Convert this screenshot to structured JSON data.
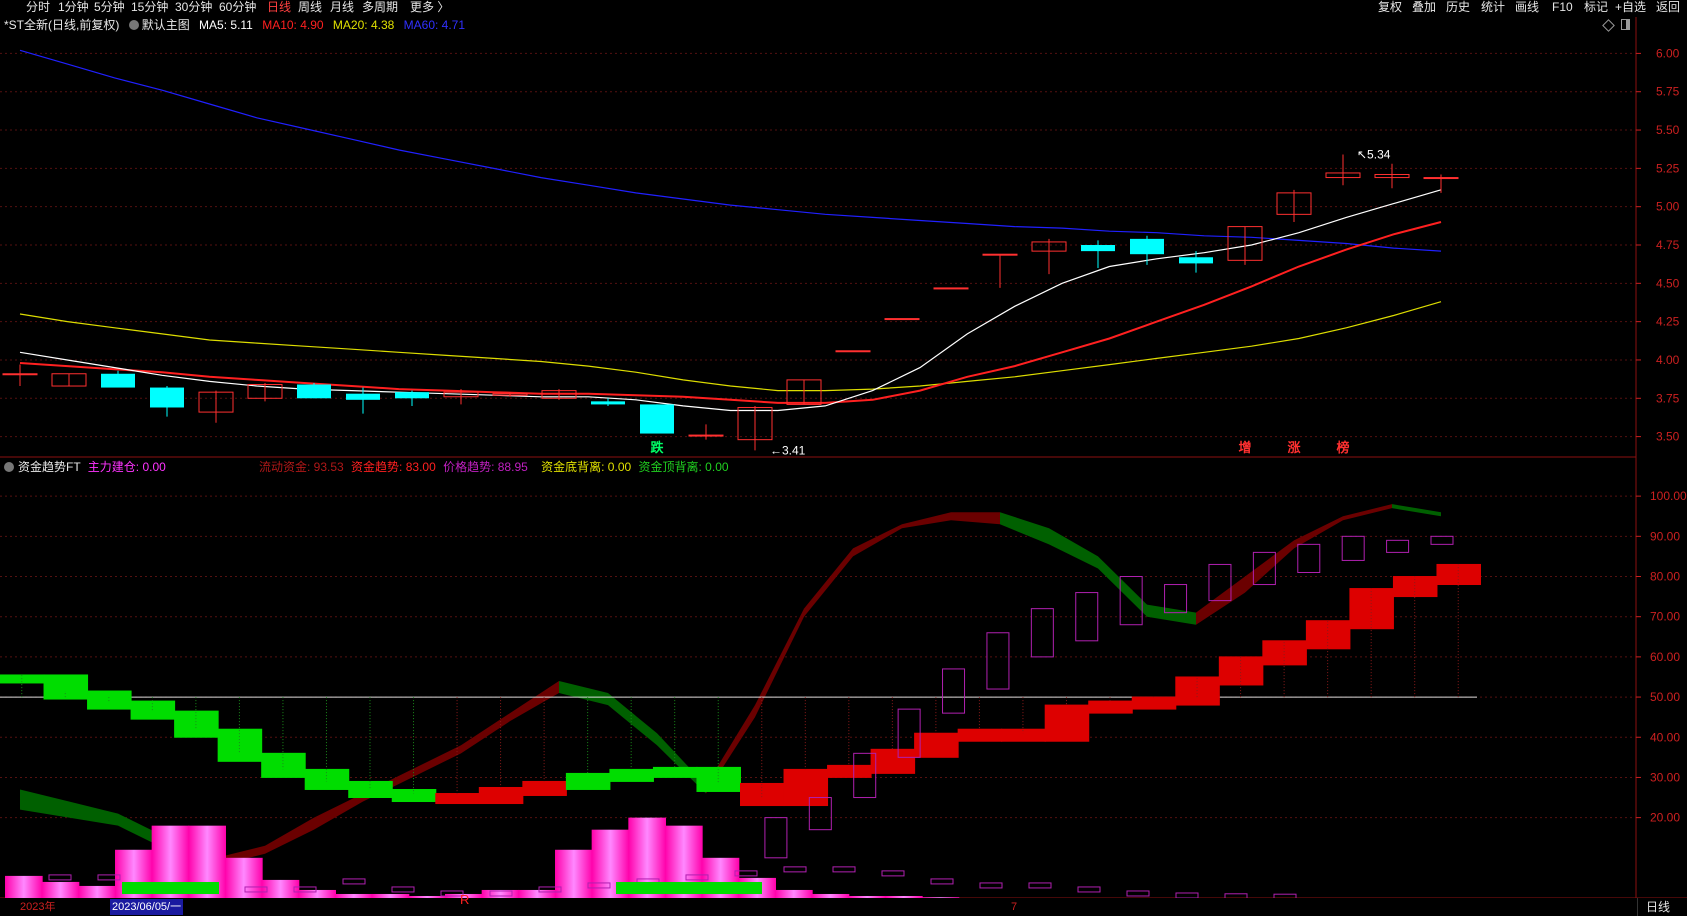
{
  "toolbar": {
    "left": [
      "分时",
      "1分钟",
      "5分钟",
      "15分钟",
      "30分钟",
      "60分钟",
      "日线",
      "周线",
      "月线",
      "多周期",
      "更多"
    ],
    "right": [
      "复权",
      "叠加",
      "历史",
      "统计",
      "画线",
      "F10",
      "标记",
      "+自选",
      "返回"
    ],
    "active": "日线",
    "more_arrow": "〉"
  },
  "main_legend": {
    "title": "*ST全新(日线,前复权)",
    "template": "默认主图",
    "ma5": "MA5: 5.11",
    "ma10": "MA10: 4.90",
    "ma20": "MA20: 4.38",
    "ma60": "MA60: 4.71"
  },
  "sub_legend": {
    "title": "资金趋势FT",
    "zhuli": "主力建仓: 0.00",
    "liudong": "流动资金: 93.53",
    "zijin_qushi": "资金趋势: 83.00",
    "jiage_qushi": "价格趋势: 88.95",
    "dibei": "资金底背离: 0.00",
    "dingbei": "资金顶背离: 0.00"
  },
  "colors": {
    "up": "#ff3030",
    "down": "#00ffff",
    "ma5": "#ffffff",
    "ma10": "#ff2020",
    "ma20": "#dddd00",
    "ma60": "#2020ff",
    "axis": "#cc2020",
    "grid": "#551111",
    "green_bar": "#00dd00",
    "red_bar": "#dd0000",
    "magenta": "#ff00ff"
  },
  "chart_data": {
    "type": "candlestick",
    "ylim": [
      3.38,
      6.12
    ],
    "yticks": [
      3.5,
      3.75,
      4.0,
      4.25,
      4.5,
      4.75,
      5.0,
      5.25,
      5.5,
      5.75,
      6.0
    ],
    "ytick_labels": [
      "3.50",
      "3.75",
      "4.00",
      "4.25",
      "4.50",
      "4.75",
      "5.00",
      "5.25",
      "5.50",
      "5.75",
      "6.00"
    ],
    "candles": [
      {
        "o": 3.91,
        "h": 3.97,
        "l": 3.83,
        "c": 3.91
      },
      {
        "o": 3.83,
        "h": 3.91,
        "l": 3.83,
        "c": 3.91
      },
      {
        "o": 3.91,
        "h": 3.93,
        "l": 3.82,
        "c": 3.82
      },
      {
        "o": 3.82,
        "h": 3.83,
        "l": 3.63,
        "c": 3.69
      },
      {
        "o": 3.66,
        "h": 3.8,
        "l": 3.59,
        "c": 3.79
      },
      {
        "o": 3.75,
        "h": 3.85,
        "l": 3.73,
        "c": 3.84
      },
      {
        "o": 3.84,
        "h": 3.85,
        "l": 3.75,
        "c": 3.75
      },
      {
        "o": 3.78,
        "h": 3.82,
        "l": 3.65,
        "c": 3.74
      },
      {
        "o": 3.79,
        "h": 3.8,
        "l": 3.7,
        "c": 3.75
      },
      {
        "o": 3.76,
        "h": 3.81,
        "l": 3.71,
        "c": 3.79
      },
      {
        "o": 3.77,
        "h": 3.79,
        "l": 3.76,
        "c": 3.78
      },
      {
        "o": 3.75,
        "h": 3.81,
        "l": 3.74,
        "c": 3.8
      },
      {
        "o": 3.73,
        "h": 3.75,
        "l": 3.7,
        "c": 3.71
      },
      {
        "o": 3.71,
        "h": 3.71,
        "l": 3.52,
        "c": 3.52
      },
      {
        "o": 3.51,
        "h": 3.58,
        "l": 3.48,
        "c": 3.51
      },
      {
        "o": 3.48,
        "h": 3.7,
        "l": 3.41,
        "c": 3.69
      },
      {
        "o": 3.71,
        "h": 3.87,
        "l": 3.71,
        "c": 3.87
      },
      {
        "o": 4.06,
        "h": 4.06,
        "l": 4.06,
        "c": 4.06
      },
      {
        "o": 4.27,
        "h": 4.27,
        "l": 4.27,
        "c": 4.27
      },
      {
        "o": 4.47,
        "h": 4.47,
        "l": 4.47,
        "c": 4.47
      },
      {
        "o": 4.69,
        "h": 4.69,
        "l": 4.47,
        "c": 4.69
      },
      {
        "o": 4.71,
        "h": 4.79,
        "l": 4.56,
        "c": 4.77
      },
      {
        "o": 4.75,
        "h": 4.78,
        "l": 4.6,
        "c": 4.71
      },
      {
        "o": 4.79,
        "h": 4.81,
        "l": 4.62,
        "c": 4.69
      },
      {
        "o": 4.67,
        "h": 4.71,
        "l": 4.57,
        "c": 4.63
      },
      {
        "o": 4.65,
        "h": 4.87,
        "l": 4.62,
        "c": 4.87
      },
      {
        "o": 4.95,
        "h": 5.11,
        "l": 4.9,
        "c": 5.09
      },
      {
        "o": 5.19,
        "h": 5.34,
        "l": 5.14,
        "c": 5.22
      },
      {
        "o": 5.19,
        "h": 5.28,
        "l": 5.12,
        "c": 5.21
      },
      {
        "o": 5.19,
        "h": 5.21,
        "l": 5.09,
        "c": 5.19
      }
    ],
    "ma5": [
      4.05,
      4.0,
      3.95,
      3.9,
      3.86,
      3.83,
      3.81,
      3.8,
      3.79,
      3.78,
      3.77,
      3.76,
      3.76,
      3.74,
      3.7,
      3.67,
      3.67,
      3.7,
      3.8,
      3.95,
      4.17,
      4.35,
      4.5,
      4.61,
      4.66,
      4.7,
      4.75,
      4.83,
      4.93,
      5.02,
      5.11
    ],
    "ma10": [
      3.98,
      3.96,
      3.94,
      3.92,
      3.89,
      3.87,
      3.85,
      3.83,
      3.81,
      3.8,
      3.79,
      3.78,
      3.78,
      3.77,
      3.76,
      3.74,
      3.72,
      3.72,
      3.74,
      3.8,
      3.89,
      3.96,
      4.05,
      4.14,
      4.25,
      4.36,
      4.48,
      4.61,
      4.72,
      4.82,
      4.9
    ],
    "ma20": [
      4.3,
      4.25,
      4.21,
      4.17,
      4.13,
      4.11,
      4.09,
      4.07,
      4.05,
      4.03,
      4.01,
      3.99,
      3.96,
      3.92,
      3.87,
      3.83,
      3.8,
      3.8,
      3.81,
      3.83,
      3.86,
      3.89,
      3.93,
      3.97,
      4.01,
      4.05,
      4.09,
      4.14,
      4.21,
      4.29,
      4.38
    ],
    "ma60": [
      6.02,
      5.93,
      5.84,
      5.76,
      5.67,
      5.58,
      5.51,
      5.44,
      5.37,
      5.31,
      5.25,
      5.19,
      5.14,
      5.09,
      5.05,
      5.01,
      4.98,
      4.95,
      4.93,
      4.91,
      4.89,
      4.87,
      4.86,
      4.84,
      4.83,
      4.81,
      4.8,
      4.78,
      4.76,
      4.73,
      4.71
    ],
    "annotations": {
      "high": "5.34",
      "low": "3.41"
    },
    "signals": [
      {
        "idx": 13,
        "text": "跌",
        "color": "#00ff66"
      },
      {
        "idx": 25,
        "text": "增",
        "color": "#ff3030"
      },
      {
        "idx": 26,
        "text": "涨",
        "color": "#ff3030"
      },
      {
        "idx": 27,
        "text": "榜",
        "color": "#ff3030"
      }
    ]
  },
  "indicator": {
    "ylim": [
      0,
      107
    ],
    "yticks": [
      20,
      30,
      40,
      50,
      60,
      70,
      80,
      90,
      100
    ],
    "ytick_labels": [
      "20.00",
      "30.00",
      "40.00",
      "50.00",
      "60.00",
      "70.00",
      "80.00",
      "90.00",
      "100.00"
    ],
    "steps": [
      55.5,
      51.5,
      49,
      46.5,
      42,
      36,
      32,
      29,
      27,
      26,
      25.5,
      27.5,
      29,
      31,
      32,
      32.5,
      28.5,
      25,
      32,
      33,
      37,
      41,
      42,
      41,
      48,
      49,
      50,
      55,
      60,
      64,
      69,
      77,
      80,
      83
    ],
    "purple_boxes": [
      [
        0,
        0
      ],
      [
        0,
        0
      ],
      [
        0,
        0
      ],
      [
        0,
        0
      ],
      [
        0,
        0
      ],
      [
        0,
        0
      ],
      [
        0,
        0
      ],
      [
        0,
        0
      ],
      [
        0,
        0
      ],
      [
        0,
        0
      ],
      [
        0,
        0
      ],
      [
        0,
        0
      ],
      [
        0,
        0
      ],
      [
        0,
        0
      ],
      [
        0,
        0
      ],
      [
        0,
        0
      ],
      [
        0,
        0
      ],
      [
        10,
        20
      ],
      [
        17,
        25
      ],
      [
        25,
        36
      ],
      [
        35,
        47
      ],
      [
        46,
        57
      ],
      [
        52,
        66
      ],
      [
        60,
        72
      ],
      [
        64,
        76
      ],
      [
        68,
        80
      ],
      [
        71,
        78
      ],
      [
        74,
        83
      ],
      [
        78,
        86
      ],
      [
        81,
        88
      ],
      [
        84,
        90
      ],
      [
        86,
        89
      ],
      [
        88,
        90
      ]
    ],
    "ribbon_top": [
      27,
      24,
      21,
      15,
      10,
      13,
      20,
      26,
      32,
      38,
      46,
      54,
      51,
      41,
      28,
      48,
      72,
      87,
      93,
      96,
      96,
      92,
      85,
      73,
      71,
      80,
      89,
      95,
      98,
      96
    ],
    "ribbon_bot": [
      22,
      20,
      18,
      12,
      8,
      11,
      17,
      24,
      30,
      36,
      44,
      51,
      48,
      38,
      26,
      45,
      70,
      85,
      92,
      94,
      93,
      88,
      82,
      70,
      68,
      76,
      87,
      94,
      97,
      95
    ],
    "bottom_hist": [
      5.5,
      4,
      3,
      12,
      18,
      18,
      10,
      4.5,
      2,
      1,
      1,
      0.5,
      1,
      2,
      2,
      12,
      17,
      20,
      18,
      10,
      5,
      2,
      1,
      0.5,
      0.5,
      0.2,
      0,
      0,
      0,
      0
    ],
    "bottom_outline": [
      5,
      5,
      3,
      3,
      2,
      2,
      4,
      2,
      1,
      1,
      2,
      3,
      4,
      5,
      6,
      7,
      7,
      6,
      4,
      3,
      3,
      2,
      1,
      0.5,
      0.3,
      0.2
    ]
  },
  "status": {
    "year": "2023年",
    "date": "2023/06/05/一",
    "marker_r": "R",
    "marker_7": "7",
    "period": "日线"
  }
}
